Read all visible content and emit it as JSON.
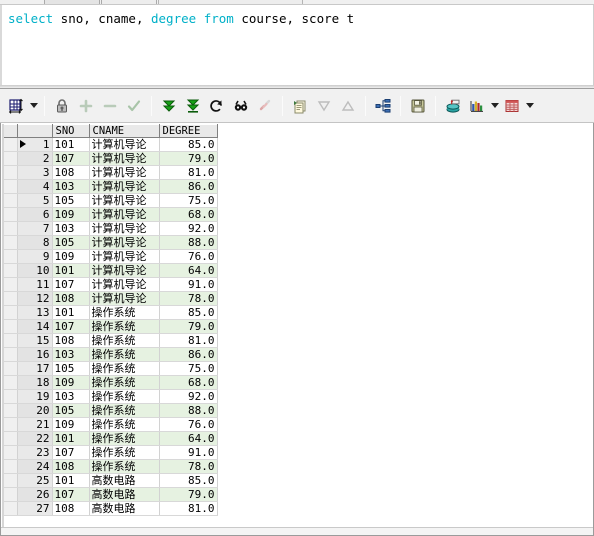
{
  "window": {
    "tabs": [
      {
        "label": ""
      },
      {
        "label": ""
      }
    ]
  },
  "editor": {
    "name": "sql-editor",
    "tokens": [
      {
        "text": "select",
        "type": "keyword"
      },
      {
        "text": " sno, cname, ",
        "type": "plain"
      },
      {
        "text": "degree",
        "type": "keyword"
      },
      {
        "text": " ",
        "type": "plain"
      },
      {
        "text": "from",
        "type": "keyword"
      },
      {
        "text": " course, score t",
        "type": "plain"
      }
    ],
    "full_text": "select sno, cname, degree from course, score t",
    "keyword_color": "#00b0c8",
    "text_color": "#000000",
    "background": "#ffffff"
  },
  "toolbar": {
    "items": [
      {
        "name": "grid-layout-icon",
        "title": "Grid / Record layout",
        "kind": "icon"
      },
      {
        "name": "grid-layout-caret",
        "title": "Layout options",
        "kind": "caret"
      },
      {
        "name": "separator-1",
        "kind": "separator"
      },
      {
        "name": "lock-icon",
        "title": "Lock / Read only",
        "kind": "icon"
      },
      {
        "name": "add-record-icon",
        "title": "Insert record",
        "kind": "icon"
      },
      {
        "name": "delete-record-icon",
        "title": "Delete record",
        "kind": "icon"
      },
      {
        "name": "commit-check-icon",
        "title": "Post / Commit",
        "kind": "icon"
      },
      {
        "name": "separator-2",
        "kind": "separator"
      },
      {
        "name": "fetch-next-icon",
        "title": "Fetch next page",
        "kind": "icon"
      },
      {
        "name": "fetch-all-icon",
        "title": "Fetch last page",
        "kind": "icon"
      },
      {
        "name": "refresh-icon",
        "title": "Refresh",
        "kind": "icon"
      },
      {
        "name": "find-icon",
        "title": "Find",
        "kind": "icon"
      },
      {
        "name": "link-icon",
        "title": "Link",
        "kind": "icon"
      },
      {
        "name": "separator-3",
        "kind": "separator"
      },
      {
        "name": "copy-rows-icon",
        "title": "Copy to clipboard",
        "kind": "icon"
      },
      {
        "name": "sort-down-icon",
        "title": "Sort descending",
        "kind": "icon"
      },
      {
        "name": "sort-up-icon",
        "title": "Sort ascending",
        "kind": "icon"
      },
      {
        "name": "separator-4",
        "kind": "separator"
      },
      {
        "name": "explain-plan-icon",
        "title": "Explain plan",
        "kind": "icon"
      },
      {
        "name": "separator-5",
        "kind": "separator"
      },
      {
        "name": "save-icon",
        "title": "Export data",
        "kind": "icon"
      },
      {
        "name": "separator-6",
        "kind": "separator"
      },
      {
        "name": "database-icon",
        "title": "Session",
        "kind": "icon"
      },
      {
        "name": "chart-icon",
        "title": "Chart",
        "kind": "icon"
      },
      {
        "name": "chart-caret",
        "title": "Chart options",
        "kind": "caret"
      },
      {
        "name": "table-icon",
        "title": "Table view",
        "kind": "icon"
      },
      {
        "name": "table-caret",
        "title": "View options",
        "kind": "caret"
      }
    ]
  },
  "grid": {
    "name": "result-grid",
    "columns": [
      "SNO",
      "CNAME",
      "DEGREE"
    ],
    "selected_row": 1,
    "row_count": 27,
    "row_stripe_color": "#e6f2e1",
    "rows": [
      {
        "n": 1,
        "sno": "101",
        "cname": "计算机导论",
        "degree": "85.0"
      },
      {
        "n": 2,
        "sno": "107",
        "cname": "计算机导论",
        "degree": "79.0"
      },
      {
        "n": 3,
        "sno": "108",
        "cname": "计算机导论",
        "degree": "81.0"
      },
      {
        "n": 4,
        "sno": "103",
        "cname": "计算机导论",
        "degree": "86.0"
      },
      {
        "n": 5,
        "sno": "105",
        "cname": "计算机导论",
        "degree": "75.0"
      },
      {
        "n": 6,
        "sno": "109",
        "cname": "计算机导论",
        "degree": "68.0"
      },
      {
        "n": 7,
        "sno": "103",
        "cname": "计算机导论",
        "degree": "92.0"
      },
      {
        "n": 8,
        "sno": "105",
        "cname": "计算机导论",
        "degree": "88.0"
      },
      {
        "n": 9,
        "sno": "109",
        "cname": "计算机导论",
        "degree": "76.0"
      },
      {
        "n": 10,
        "sno": "101",
        "cname": "计算机导论",
        "degree": "64.0"
      },
      {
        "n": 11,
        "sno": "107",
        "cname": "计算机导论",
        "degree": "91.0"
      },
      {
        "n": 12,
        "sno": "108",
        "cname": "计算机导论",
        "degree": "78.0"
      },
      {
        "n": 13,
        "sno": "101",
        "cname": "操作系统",
        "degree": "85.0"
      },
      {
        "n": 14,
        "sno": "107",
        "cname": "操作系统",
        "degree": "79.0"
      },
      {
        "n": 15,
        "sno": "108",
        "cname": "操作系统",
        "degree": "81.0"
      },
      {
        "n": 16,
        "sno": "103",
        "cname": "操作系统",
        "degree": "86.0"
      },
      {
        "n": 17,
        "sno": "105",
        "cname": "操作系统",
        "degree": "75.0"
      },
      {
        "n": 18,
        "sno": "109",
        "cname": "操作系统",
        "degree": "68.0"
      },
      {
        "n": 19,
        "sno": "103",
        "cname": "操作系统",
        "degree": "92.0"
      },
      {
        "n": 20,
        "sno": "105",
        "cname": "操作系统",
        "degree": "88.0"
      },
      {
        "n": 21,
        "sno": "109",
        "cname": "操作系统",
        "degree": "76.0"
      },
      {
        "n": 22,
        "sno": "101",
        "cname": "操作系统",
        "degree": "64.0"
      },
      {
        "n": 23,
        "sno": "107",
        "cname": "操作系统",
        "degree": "91.0"
      },
      {
        "n": 24,
        "sno": "108",
        "cname": "操作系统",
        "degree": "78.0"
      },
      {
        "n": 25,
        "sno": "101",
        "cname": "高数电路",
        "degree": "85.0"
      },
      {
        "n": 26,
        "sno": "107",
        "cname": "高数电路",
        "degree": "79.0"
      },
      {
        "n": 27,
        "sno": "108",
        "cname": "高数电路",
        "degree": "81.0"
      }
    ]
  }
}
